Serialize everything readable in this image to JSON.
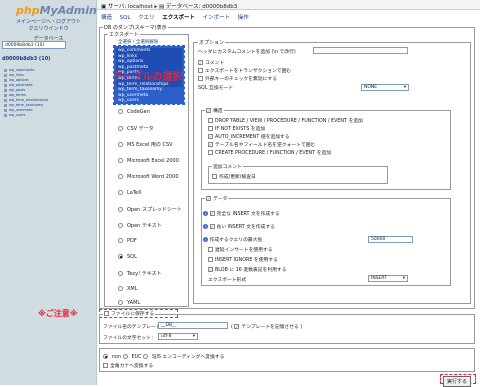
{
  "sidebar": {
    "logo_php": "php",
    "logo_my": "MyAdmin",
    "links": [
      "メインページへ・ログアウト",
      "クエリウインドウ"
    ],
    "db_label": "データベース",
    "db_select": "d0000b8db3 (10)",
    "db_title": "d0000b8db3 (10)",
    "tables": [
      "wp_comments",
      "wp_links",
      "wp_options",
      "wp_postmeta",
      "wp_posts",
      "wp_terms",
      "wp_term_relationships",
      "wp_term_taxonomy",
      "wp_usermeta",
      "wp_users"
    ]
  },
  "topbar": {
    "server": "サーバ: localhost",
    "db": "データベース: d0000b8db3"
  },
  "tabs": [
    "構造",
    "SQL",
    "クエリ",
    "エクスポート",
    "インポート",
    "操作"
  ],
  "dump": {
    "title": "DB のダンプ(スキーマ)表示",
    "export_legend": "エクスポート",
    "select_all": "全選択",
    "unselect_all": "全選択解除",
    "overlay_text": "テーブルの選択",
    "items": [
      "wp_comments",
      "wp_links",
      "wp_options",
      "wp_postmeta",
      "wp_posts",
      "wp_terms",
      "wp_term_relationships",
      "wp_term_taxonomy",
      "wp_usermeta",
      "wp_users"
    ],
    "formats": [
      "CodeGen",
      "CSV データ",
      "MS Excel 用の CSV",
      "Microsoft Excel 2000",
      "Microsoft Word 2000",
      "LaTeX",
      "Open スプレッドシート",
      "Open テキスト",
      "PDF",
      "SQL",
      "Texy! テキスト",
      "XML",
      "YAML"
    ],
    "selected_format": "SQL"
  },
  "options": {
    "legend": "オプション",
    "header_comment_label": "ヘッダにカスタムコメントを追加 (\\n で改行)",
    "comment": "コメント",
    "transaction": "エクスポートをトランザクションで囲む",
    "fk_checks": "外部キーのチェックを無効にする",
    "compat_label": "SQL 互換モード",
    "compat_value": "NONE",
    "structure_legend": "構造",
    "structure_opts": [
      "DROP TABLE / VIEW / PROCEDURE / FUNCTION / EVENT を追加",
      "IF NOT EXISTS を追加",
      "AUTO_INCREMENT 値を追加する",
      "テーブル名やフィールド名を逆クォートで囲む",
      "CREATE PROCEDURE / FUNCTION / EVENT を追加"
    ],
    "add_comment_legend": "追加コメント",
    "add_comment_opt": "作成/更新/検査日",
    "data_legend": "データ",
    "data_opts": [
      "完全な INSERT 文を作成する",
      "長い INSERT 文を作成する"
    ],
    "maxlen_label": "作成するクエリの最大長",
    "maxlen_value": "50000",
    "data_opts2": [
      "遅延インサートを使用する",
      "INSERT IGNORE を使用する",
      "BLOB に 16 進数表記を利用する"
    ],
    "export_type_label": "エクスポート形式",
    "export_type_value": "INSERT"
  },
  "save": {
    "caution": "※ご注意※",
    "save_as_file": "ファイルに保存する",
    "template_label": "ファイル名のテンプレート：",
    "template_value": "__DB__",
    "remember_template": "テンプレートを記憶させる",
    "charset_label": "ファイルの文字セット：",
    "charset_value": "utf-8"
  },
  "encoding": {
    "options": [
      "non",
      "EUC",
      "SJIS",
      "エンコーディングへ変換する"
    ],
    "zenkaku": "全角カナへ変換する",
    "execute": "実行する"
  }
}
